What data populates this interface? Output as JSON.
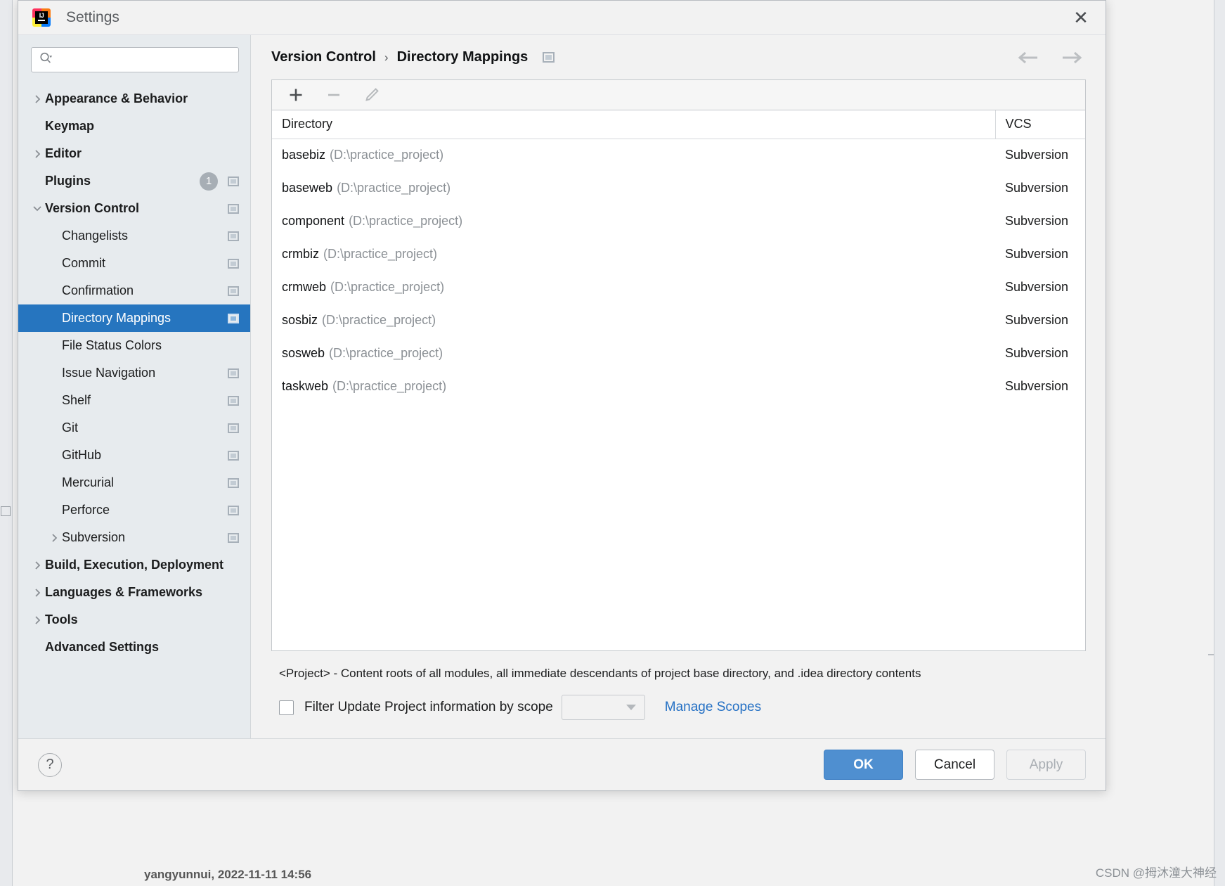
{
  "window": {
    "title": "Settings",
    "logo_icon": "intellij-idea-logo",
    "close_icon": "close-icon"
  },
  "sidebar": {
    "search": {
      "placeholder": "",
      "value": "",
      "icon": "search-icon"
    },
    "items": [
      {
        "label": "Appearance & Behavior",
        "level": 0,
        "arrow": "chevron-right",
        "badge": null,
        "mod_icon": false,
        "selected": false
      },
      {
        "label": "Keymap",
        "level": 0,
        "arrow": null,
        "badge": null,
        "mod_icon": false,
        "selected": false
      },
      {
        "label": "Editor",
        "level": 0,
        "arrow": "chevron-right",
        "badge": null,
        "mod_icon": false,
        "selected": false
      },
      {
        "label": "Plugins",
        "level": 0,
        "arrow": null,
        "badge": "1",
        "mod_icon": true,
        "selected": false
      },
      {
        "label": "Version Control",
        "level": 0,
        "arrow": "chevron-down",
        "badge": null,
        "mod_icon": true,
        "selected": false
      },
      {
        "label": "Changelists",
        "level": 1,
        "arrow": null,
        "badge": null,
        "mod_icon": true,
        "selected": false
      },
      {
        "label": "Commit",
        "level": 1,
        "arrow": null,
        "badge": null,
        "mod_icon": true,
        "selected": false
      },
      {
        "label": "Confirmation",
        "level": 1,
        "arrow": null,
        "badge": null,
        "mod_icon": true,
        "selected": false
      },
      {
        "label": "Directory Mappings",
        "level": 1,
        "arrow": null,
        "badge": null,
        "mod_icon": true,
        "selected": true
      },
      {
        "label": "File Status Colors",
        "level": 1,
        "arrow": null,
        "badge": null,
        "mod_icon": false,
        "selected": false
      },
      {
        "label": "Issue Navigation",
        "level": 1,
        "arrow": null,
        "badge": null,
        "mod_icon": true,
        "selected": false
      },
      {
        "label": "Shelf",
        "level": 1,
        "arrow": null,
        "badge": null,
        "mod_icon": true,
        "selected": false
      },
      {
        "label": "Git",
        "level": 1,
        "arrow": null,
        "badge": null,
        "mod_icon": true,
        "selected": false
      },
      {
        "label": "GitHub",
        "level": 1,
        "arrow": null,
        "badge": null,
        "mod_icon": true,
        "selected": false
      },
      {
        "label": "Mercurial",
        "level": 1,
        "arrow": null,
        "badge": null,
        "mod_icon": true,
        "selected": false
      },
      {
        "label": "Perforce",
        "level": 1,
        "arrow": null,
        "badge": null,
        "mod_icon": true,
        "selected": false
      },
      {
        "label": "Subversion",
        "level": 1,
        "arrow": "chevron-right",
        "badge": null,
        "mod_icon": true,
        "selected": false
      },
      {
        "label": "Build, Execution, Deployment",
        "level": 0,
        "arrow": "chevron-right",
        "badge": null,
        "mod_icon": false,
        "selected": false
      },
      {
        "label": "Languages & Frameworks",
        "level": 0,
        "arrow": "chevron-right",
        "badge": null,
        "mod_icon": false,
        "selected": false
      },
      {
        "label": "Tools",
        "level": 0,
        "arrow": "chevron-right",
        "badge": null,
        "mod_icon": false,
        "selected": false
      },
      {
        "label": "Advanced Settings",
        "level": 0,
        "arrow": null,
        "badge": null,
        "mod_icon": false,
        "selected": false
      }
    ]
  },
  "main": {
    "breadcrumb": {
      "parent": "Version Control",
      "separator": "›",
      "current": "Directory Mappings",
      "scope_icon": "project-scope-icon"
    },
    "nav": {
      "back_icon": "arrow-left-icon",
      "forward_icon": "arrow-right-icon"
    },
    "toolbar": [
      {
        "name": "add-mapping-button",
        "icon": "plus-icon",
        "enabled": true
      },
      {
        "name": "remove-mapping-button",
        "icon": "minus-icon",
        "enabled": false
      },
      {
        "name": "edit-mapping-button",
        "icon": "pencil-icon",
        "enabled": false
      }
    ],
    "table": {
      "columns": [
        "Directory",
        "VCS"
      ],
      "rows": [
        {
          "name": "basebiz",
          "path": "(D:\\practice_project)",
          "vcs": "Subversion"
        },
        {
          "name": "baseweb",
          "path": "(D:\\practice_project)",
          "vcs": "Subversion"
        },
        {
          "name": "component",
          "path": "(D:\\practice_project)",
          "vcs": "Subversion"
        },
        {
          "name": "crmbiz",
          "path": "(D:\\practice_project)",
          "vcs": "Subversion"
        },
        {
          "name": "crmweb",
          "path": "(D:\\practice_project)",
          "vcs": "Subversion"
        },
        {
          "name": "sosbiz",
          "path": "(D:\\practice_project)",
          "vcs": "Subversion"
        },
        {
          "name": "sosweb",
          "path": "(D:\\practice_project)",
          "vcs": "Subversion"
        },
        {
          "name": "taskweb",
          "path": "(D:\\practice_project)",
          "vcs": "Subversion"
        }
      ]
    },
    "footer_note": "<Project> - Content roots of all modules, all immediate descendants of project base directory, and .idea directory contents",
    "scope_filter": {
      "checked": false,
      "label": "Filter Update Project information by scope",
      "select_value": "",
      "manage_link": "Manage Scopes"
    }
  },
  "bottom": {
    "help_label": "?",
    "ok_label": "OK",
    "cancel_label": "Cancel",
    "apply_label": "Apply"
  },
  "backdrop": {
    "editor_text": "yangyunnui, 2022-11-11 14:56",
    "watermark": "CSDN @拇沐潼大神经"
  },
  "colors": {
    "accent_blue": "#2675bf",
    "primary_button": "#4f8fd0",
    "link": "#2470c4",
    "sidebar_bg": "#e7ebee",
    "panel_bg": "#f2f2f2"
  }
}
